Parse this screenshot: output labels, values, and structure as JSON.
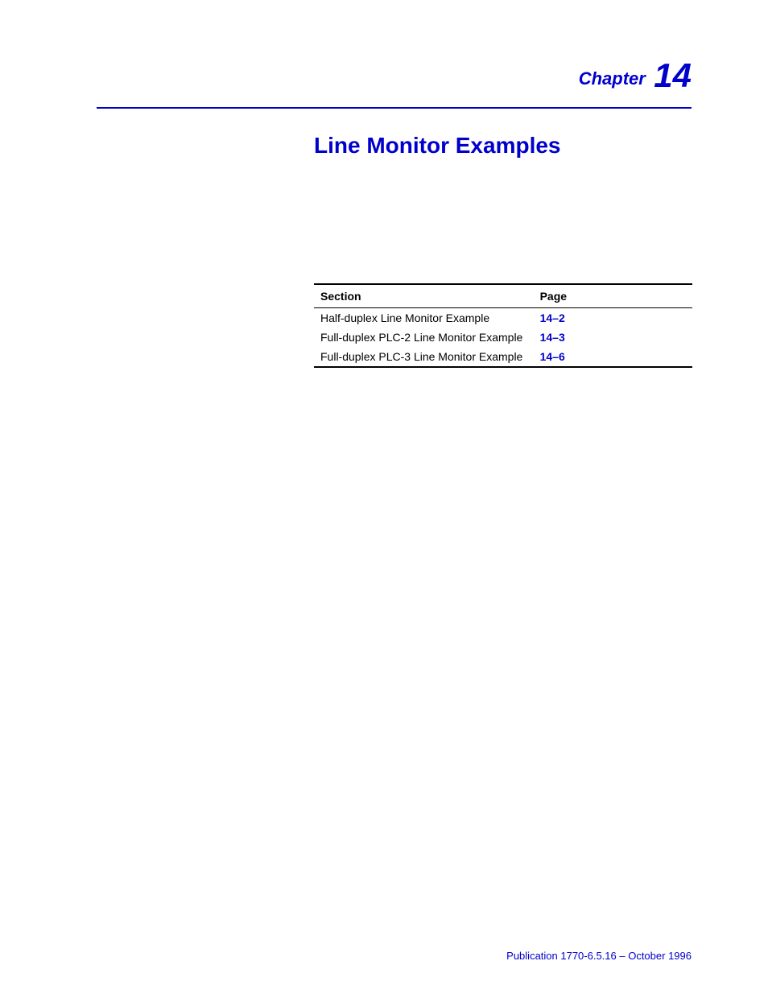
{
  "header": {
    "chapter_label": "Chapter",
    "chapter_number": "14"
  },
  "title": "Line Monitor Examples",
  "table": {
    "headers": {
      "section": "Section",
      "page": "Page"
    },
    "rows": [
      {
        "section": "Half-duplex Line Monitor Example",
        "page": "14–2"
      },
      {
        "section": "Full-duplex PLC-2 Line Monitor Example",
        "page": "14–3"
      },
      {
        "section": "Full-duplex PLC-3 Line Monitor Example",
        "page": "14–6"
      }
    ]
  },
  "footer": {
    "publication": "Publication 1770-6.5.16 – October 1996"
  }
}
